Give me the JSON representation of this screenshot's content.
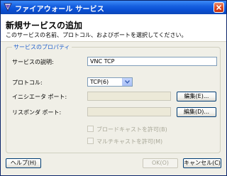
{
  "window": {
    "title": "ファイアウォール サービス",
    "close_icon": "close-icon",
    "app_icon": "firewall-app-icon"
  },
  "header": {
    "title": "新規サービスの追加",
    "description": "このサービスの名前、プロトコル、およびポートを選択してください。"
  },
  "properties": {
    "legend": "サービスのプロパティ",
    "service_description_label": "サービスの説明:",
    "service_description_value": "VNC TCP",
    "protocol_label": "プロトコル:",
    "protocol_value": "TCP(6)",
    "initiator_port_label": "イニシエータ ポート:",
    "initiator_port_value": "",
    "initiator_edit_button": "編集(E)...",
    "responder_port_label": "リスポンダ ポート:",
    "responder_port_value": "",
    "responder_edit_button": "編集(D)...",
    "allow_broadcast_label": "ブロードキャストを許可(B)",
    "allow_multicast_label": "マルチキャストを許可(M)"
  },
  "buttons": {
    "help": "ヘルプ(H)",
    "ok": "OK(O)",
    "cancel": "キャンセル(C)"
  }
}
